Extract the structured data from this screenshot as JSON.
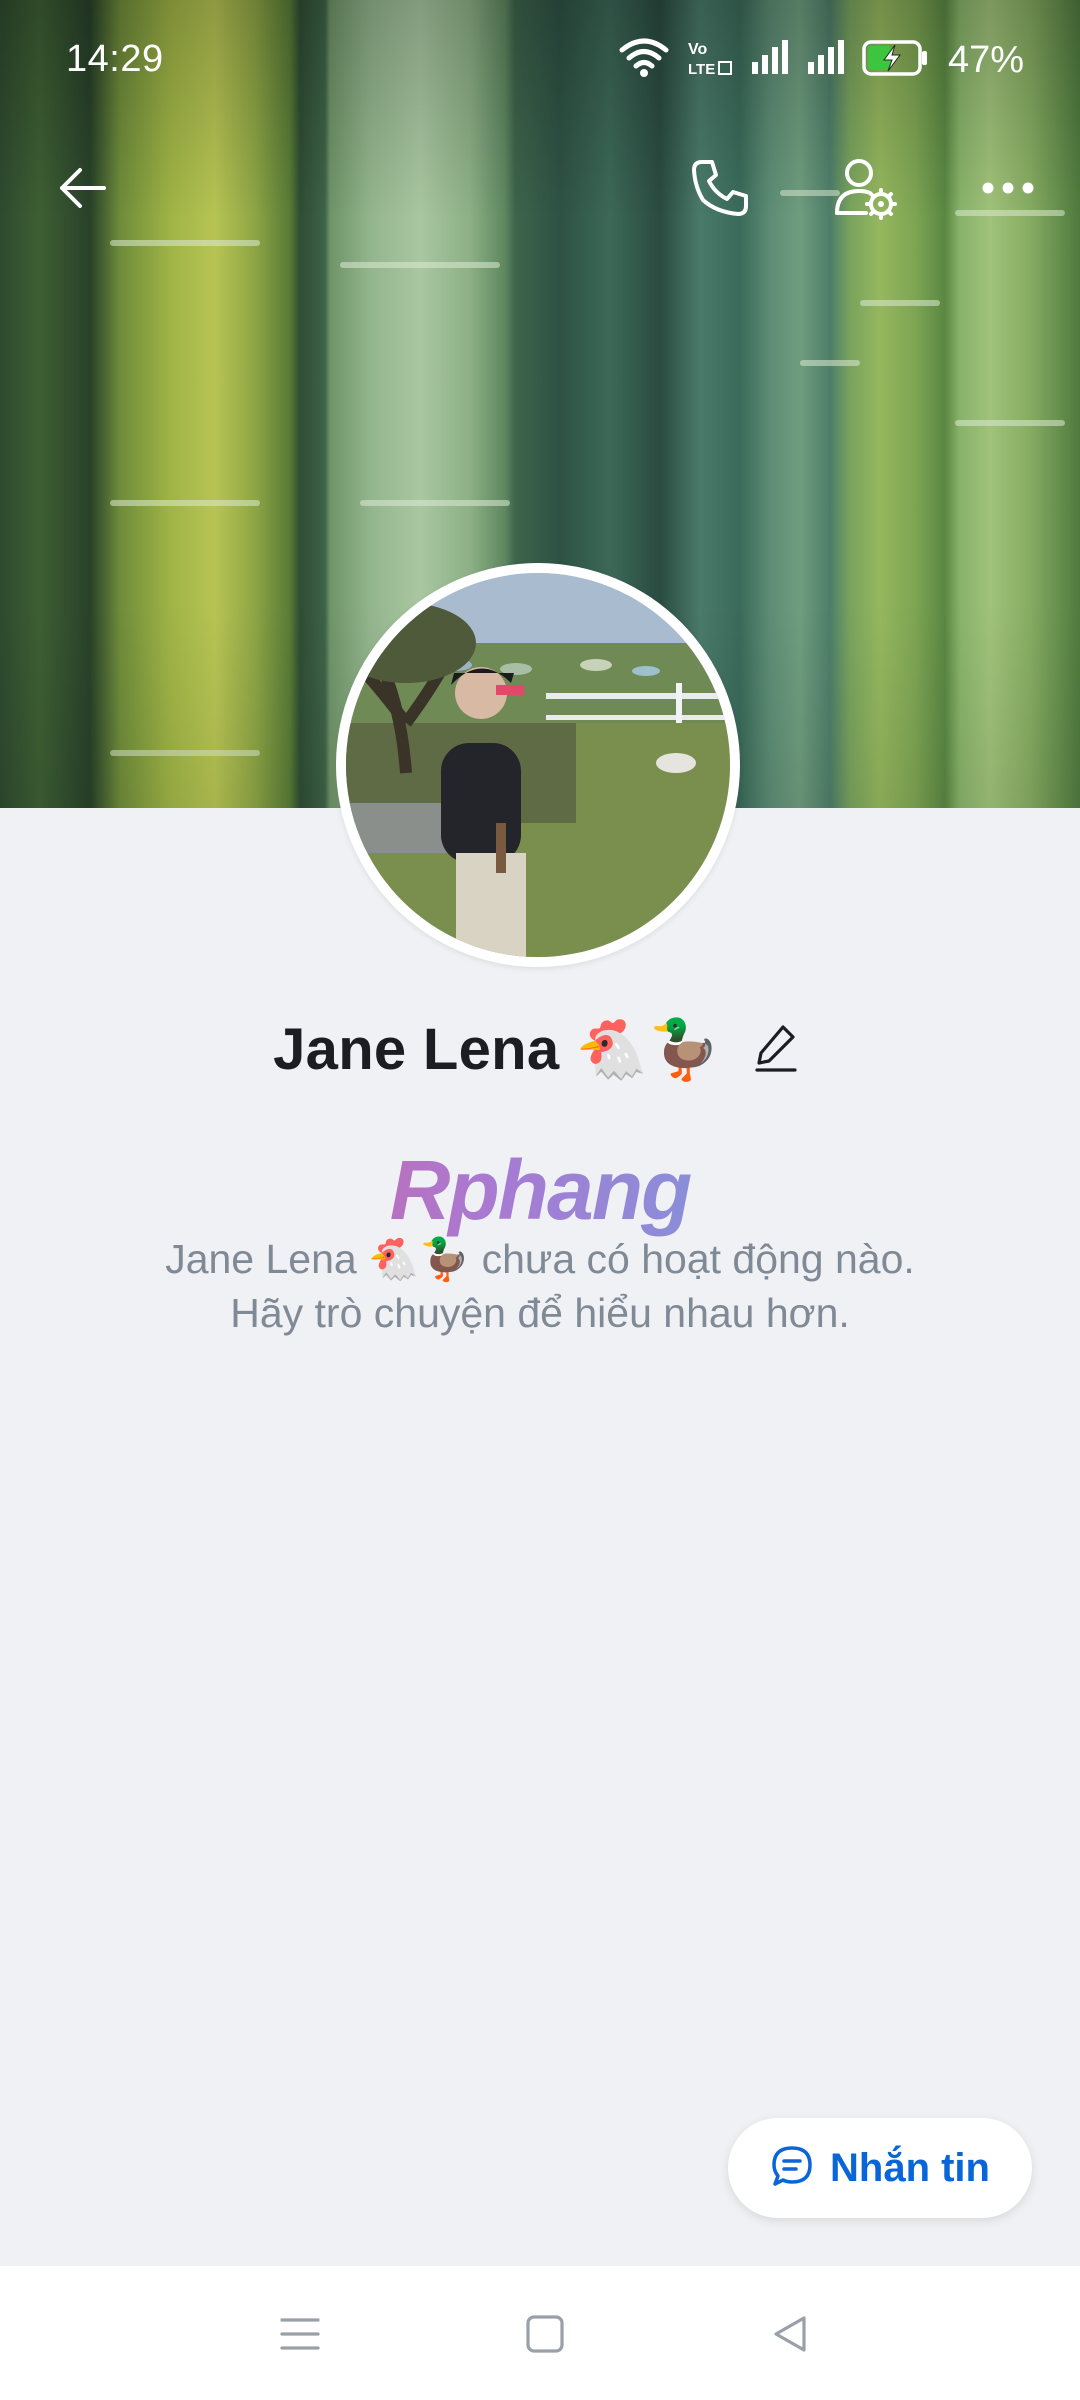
{
  "status_bar": {
    "time": "14:29",
    "network_badge": "Vo LTE",
    "battery_percent": "47%",
    "battery_level": 0.47,
    "icons": [
      "wifi-icon",
      "volte-icon",
      "signal-icon",
      "signal-icon",
      "battery-charging-icon"
    ]
  },
  "toolbar": {
    "back_icon": "arrow-left-icon",
    "call_icon": "phone-icon",
    "settings_icon": "user-settings-icon",
    "more_icon": "more-dots-icon",
    "icon_color": "#ffffff"
  },
  "profile": {
    "name": "Jane Lena 🐔🦆",
    "edit_icon": "pencil-icon"
  },
  "watermark": {
    "text": "Rphang"
  },
  "empty_state": {
    "line1": "Jane Lena 🐔🦆 chưa có hoạt động nào.",
    "line2": "Hãy trò chuyện để hiểu nhau hơn."
  },
  "message_button": {
    "label": "Nhắn tin",
    "icon": "chat-bubble-icon",
    "color": "#0a66d8"
  },
  "nav_bar": {
    "icons": [
      "menu-icon",
      "home-square-icon",
      "back-triangle-icon"
    ]
  },
  "colors": {
    "background": "#f0f1f4",
    "name_text": "#1b1d22",
    "empty_text": "#808a96",
    "accent": "#0a66d8"
  }
}
